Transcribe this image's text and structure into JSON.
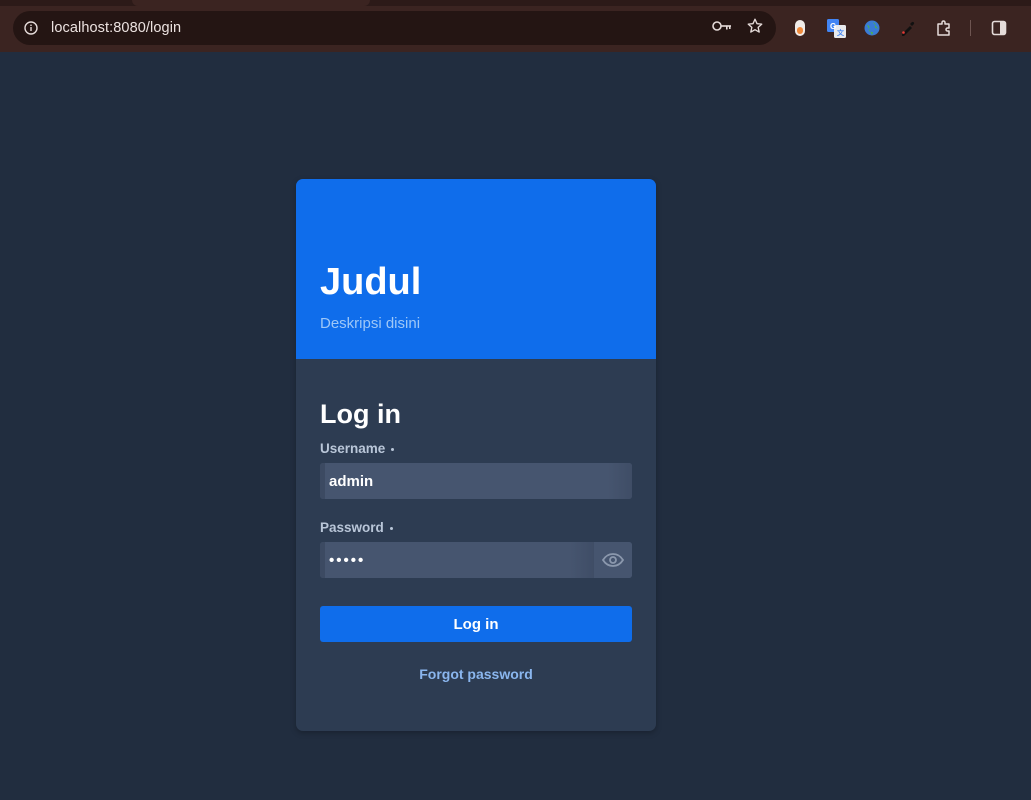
{
  "browser": {
    "url": "localhost:8080/login",
    "icons": [
      "info-icon",
      "password-key-icon",
      "bookmark-star-icon"
    ],
    "extensions": [
      "extension-shield-icon",
      "google-translate-icon",
      "extension-globe-icon",
      "color-picker-icon",
      "extensions-puzzle-icon",
      "side-panel-icon"
    ]
  },
  "header": {
    "title": "Judul",
    "description": "Deskripsi disini"
  },
  "form": {
    "heading": "Log in",
    "username_label": "Username",
    "username_value": "admin",
    "password_label": "Password",
    "password_value": "•••••",
    "submit_label": "Log in",
    "forgot_label": "Forgot password"
  },
  "colors": {
    "page_bg": "#212d3f",
    "card_bg": "#2d3c52",
    "accent": "#0f6deb",
    "input_bg": "#46556f"
  }
}
